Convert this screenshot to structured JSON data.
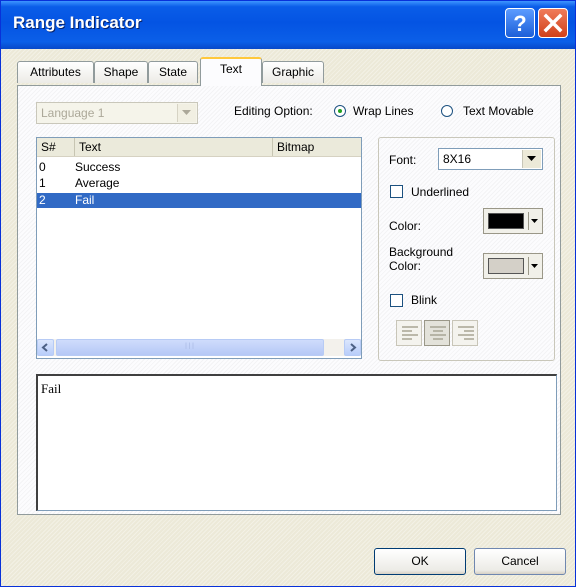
{
  "window": {
    "title": "Range Indicator"
  },
  "titlebar_icons": [
    "help-icon",
    "close-icon"
  ],
  "tabs": [
    {
      "label": "Attributes"
    },
    {
      "label": "Shape"
    },
    {
      "label": "State"
    },
    {
      "label": "Text"
    },
    {
      "label": "Graphic"
    }
  ],
  "active_tab": "Text",
  "language": {
    "value": "Language 1",
    "disabled": true
  },
  "editing_option": {
    "label": "Editing Option:",
    "options": [
      {
        "label": "Wrap Lines",
        "selected": true
      },
      {
        "label": "Text Movable",
        "selected": false
      }
    ]
  },
  "state_list": {
    "columns": [
      "S#",
      "Text",
      "Bitmap"
    ],
    "rows": [
      {
        "num": "0",
        "text": "Success"
      },
      {
        "num": "1",
        "text": "Average"
      },
      {
        "num": "2",
        "text": "Fail"
      }
    ],
    "selected_index": 2,
    "scrollbar_grip": "III"
  },
  "font_panel": {
    "font_label": "Font:",
    "font_value": "8X16",
    "underlined_label": "Underlined",
    "underlined_checked": false,
    "color_label": "Color:",
    "color_value": "#000000",
    "background_label": "Background Color:",
    "background_value": "#d4d0c8",
    "blink_label": "Blink",
    "blink_checked": false,
    "alignment_icons": [
      "align-left-icon",
      "align-center-icon",
      "align-right-icon"
    ],
    "alignment_selected": "align-center"
  },
  "text_edit": {
    "value": "Fail"
  },
  "buttons": {
    "ok": "OK",
    "cancel": "Cancel"
  },
  "colors": {
    "titlebar": "#0454e3",
    "selection": "#316ac5",
    "radio_dot": "#21a121"
  }
}
